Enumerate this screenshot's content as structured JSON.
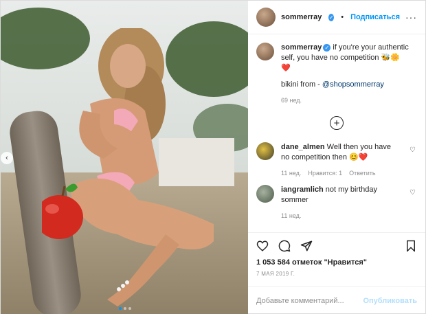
{
  "header": {
    "username": "sommerray",
    "dot": "•",
    "follow_label": "Подписаться",
    "more_label": "···"
  },
  "caption": {
    "username": "sommerray",
    "text": " if you're your authentic self, you have no competition ",
    "emojis": [
      "🐝",
      "🌼",
      "❤️"
    ],
    "line2_prefix": "bikini from - ",
    "line2_link": "@shopsommerray",
    "time": "69 нед."
  },
  "plus_label": "+",
  "comments": [
    {
      "username": "dane_almen",
      "text": " Well then you have no competition then 😊❤️",
      "time": "11 нед.",
      "likes": "Нравится: 1",
      "reply": "Ответить"
    },
    {
      "username": "iangramlich",
      "text": " not my birthday sommer",
      "time": "11 нед."
    }
  ],
  "likes_text": "1 053 584 отметок \"Нравится\"",
  "date_text": "7 мая 2019 г.",
  "add_comment": {
    "placeholder": "Добавьте комментарий...",
    "publish_label": "Опубликовать"
  },
  "colors": {
    "accent": "#0095f6",
    "verified": "#3897f0",
    "publish_disabled": "#b2dffc"
  },
  "icons": {
    "like": "heart-icon",
    "comment": "comment-icon",
    "share": "share-icon",
    "save": "bookmark-icon",
    "more": "more-icon",
    "verified": "verified-badge-icon",
    "add": "plus-circle-icon",
    "prev": "chevron-left-icon"
  }
}
